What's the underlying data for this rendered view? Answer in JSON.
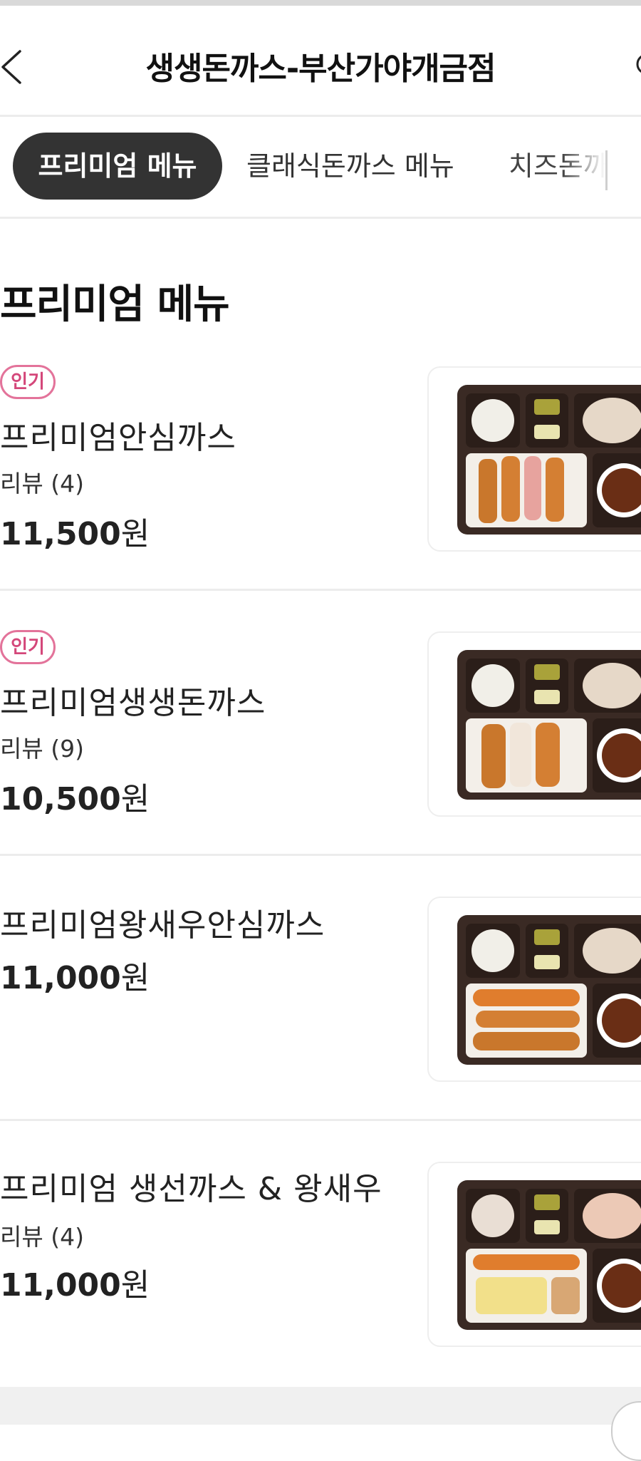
{
  "header": {
    "title": "생생돈까스-부산가야개금점"
  },
  "tabs": [
    {
      "label": "프리미엄 메뉴",
      "active": true
    },
    {
      "label": "클래식돈까스 메뉴",
      "active": false
    },
    {
      "label": "치즈돈까스",
      "active": false
    }
  ],
  "section": {
    "title": "프리미엄 메뉴"
  },
  "items": [
    {
      "badge": "인기",
      "name": "프리미엄안심까스",
      "reviews": "리뷰 (4)",
      "price": "11,500",
      "won": "원"
    },
    {
      "badge": "인기",
      "name": "프리미엄생생돈까스",
      "reviews": "리뷰 (9)",
      "price": "10,500",
      "won": "원"
    },
    {
      "badge": "",
      "name": "프리미엄왕새우안심까스",
      "reviews": "",
      "price": "11,000",
      "won": "원"
    },
    {
      "badge": "",
      "name": "프리미엄 생선까스 & 왕새우",
      "reviews": "리뷰 (4)",
      "price": "11,000",
      "won": "원"
    }
  ],
  "colors": {
    "accent_badge": "#e3739a",
    "active_tab_bg": "#333333",
    "tray": "#3a2a24"
  },
  "icons": {
    "back": "chevron-left-icon",
    "right": "partial-circle-icon"
  }
}
